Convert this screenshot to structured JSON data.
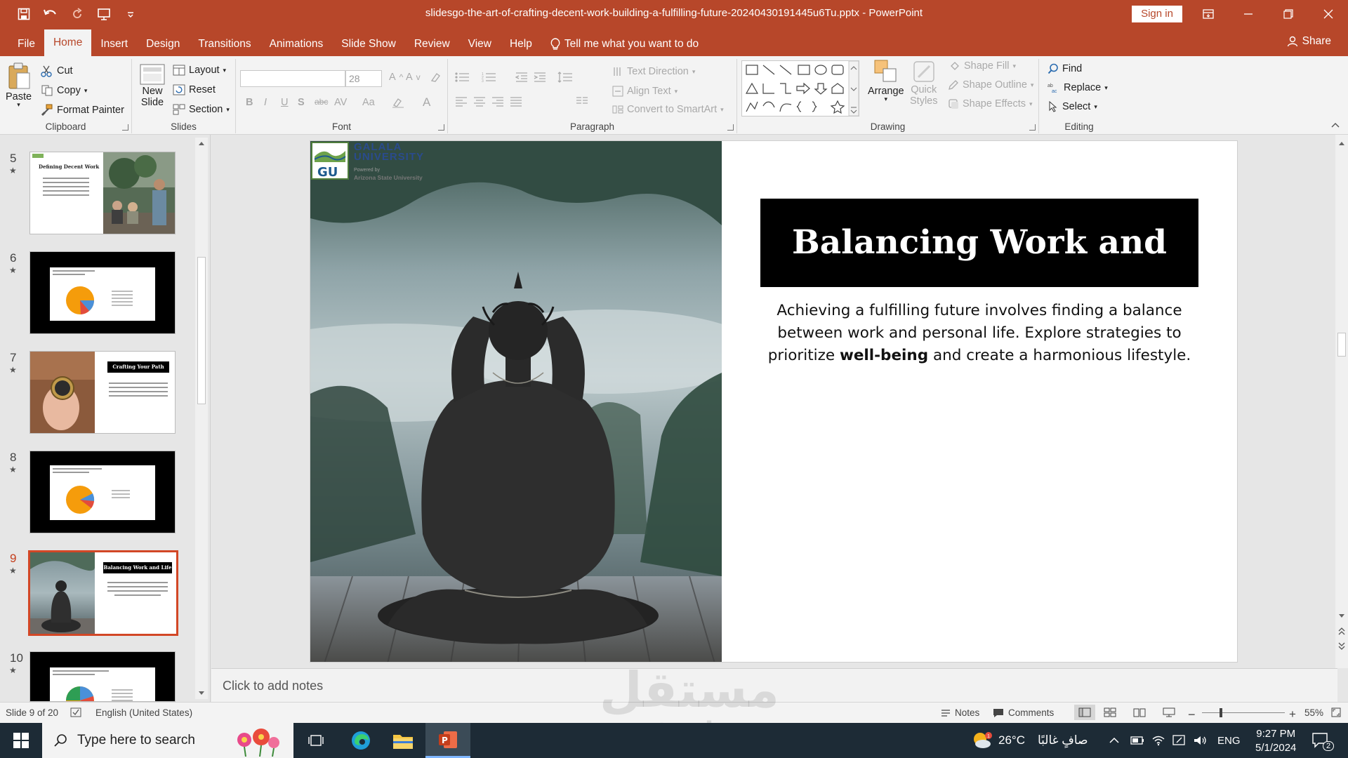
{
  "window": {
    "doc_title": "slidesgo-the-art-of-crafting-decent-work-building-a-fulfilling-future-20240430191445u6Tu.pptx  -  PowerPoint",
    "sign_in": "Sign in"
  },
  "tabs": {
    "file": "File",
    "home": "Home",
    "insert": "Insert",
    "design": "Design",
    "transitions": "Transitions",
    "animations": "Animations",
    "slide_show": "Slide Show",
    "review": "Review",
    "view": "View",
    "help": "Help",
    "tell_me": "Tell me what you want to do",
    "share": "Share"
  },
  "ribbon": {
    "clipboard": {
      "paste": "Paste",
      "cut": "Cut",
      "copy": "Copy",
      "format_painter": "Format Painter",
      "label": "Clipboard"
    },
    "slides": {
      "new_slide_1": "New",
      "new_slide_2": "Slide",
      "layout": "Layout",
      "reset": "Reset",
      "section": "Section",
      "label": "Slides"
    },
    "font": {
      "font_name": "",
      "font_size": "28",
      "bold": "B",
      "italic": "I",
      "underline": "U",
      "shadow": "S",
      "strike": "abc",
      "spacing": "AV",
      "case": "Aa",
      "label": "Font"
    },
    "paragraph": {
      "text_direction": "Text Direction",
      "align_text": "Align Text",
      "convert_smartart": "Convert to SmartArt",
      "label": "Paragraph"
    },
    "drawing": {
      "arrange": "Arrange",
      "quick_styles_1": "Quick",
      "quick_styles_2": "Styles",
      "shape_fill": "Shape Fill",
      "shape_outline": "Shape Outline",
      "shape_effects": "Shape Effects",
      "label": "Drawing"
    },
    "editing": {
      "find": "Find",
      "replace": "Replace",
      "select": "Select",
      "label": "Editing"
    }
  },
  "thumbnails": [
    {
      "num": "5",
      "title": "Defining Decent Work"
    },
    {
      "num": "6",
      "title": ""
    },
    {
      "num": "7",
      "title": "Crafting Your Path"
    },
    {
      "num": "8",
      "title": ""
    },
    {
      "num": "9",
      "title": "Balancing Work and Life"
    },
    {
      "num": "10",
      "title": ""
    }
  ],
  "slide": {
    "logo_name": "GALALA",
    "logo_name_2": "UNIVERSITY",
    "logo_powered": "Powered by",
    "logo_asu": "Arizona State University",
    "logo_mark": "GU",
    "title": "Balancing Work and Life",
    "body_1": "Achieving a fulfilling future involves finding a balance between work and personal life. Explore strategies to prioritize ",
    "body_bold": "well-being",
    "body_2": " and create a harmonious lifestyle."
  },
  "notes_placeholder": "Click to add notes",
  "status": {
    "slide_of": "Slide 9 of 20",
    "language": "English (United States)",
    "notes": "Notes",
    "comments": "Comments",
    "zoom": "55%"
  },
  "taskbar": {
    "search_placeholder": "Type here to search",
    "weather_temp": "26°C",
    "weather_desc": "صافٍ غالبًا",
    "lang": "ENG",
    "time": "9:27 PM",
    "date": "5/1/2024",
    "notif_count": "2"
  },
  "watermark": {
    "arabic": "مستقل",
    "latin": "mostaql.com"
  },
  "colors": {
    "accent": "#b7472a",
    "active_thumb": "#d24726",
    "taskbar": "#1d2b36"
  }
}
